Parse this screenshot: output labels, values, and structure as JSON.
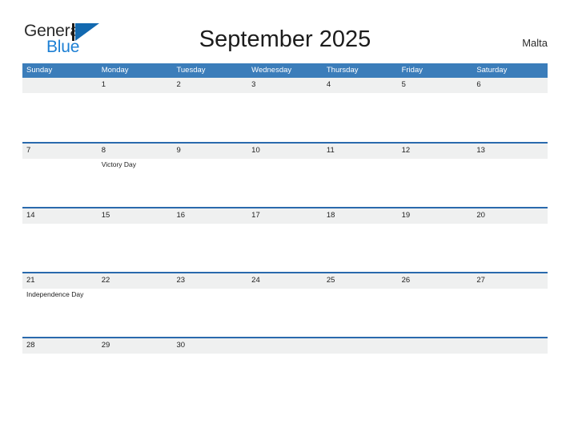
{
  "brand": {
    "name_part1": "General",
    "name_part2": "Blue",
    "color_primary": "#1c7fd4",
    "color_triangle": "#1269b0"
  },
  "header": {
    "title": "September 2025",
    "locale": "Malta"
  },
  "calendar": {
    "header_bg": "#3b7dba",
    "row_divider": "#2a6aad",
    "date_band_bg": "#eff0f0",
    "weekdays": [
      "Sunday",
      "Monday",
      "Tuesday",
      "Wednesday",
      "Thursday",
      "Friday",
      "Saturday"
    ],
    "weeks": [
      [
        {
          "date": ""
        },
        {
          "date": "1"
        },
        {
          "date": "2"
        },
        {
          "date": "3"
        },
        {
          "date": "4"
        },
        {
          "date": "5"
        },
        {
          "date": "6"
        }
      ],
      [
        {
          "date": "7"
        },
        {
          "date": "8",
          "event": "Victory Day"
        },
        {
          "date": "9"
        },
        {
          "date": "10"
        },
        {
          "date": "11"
        },
        {
          "date": "12"
        },
        {
          "date": "13"
        }
      ],
      [
        {
          "date": "14"
        },
        {
          "date": "15"
        },
        {
          "date": "16"
        },
        {
          "date": "17"
        },
        {
          "date": "18"
        },
        {
          "date": "19"
        },
        {
          "date": "20"
        }
      ],
      [
        {
          "date": "21",
          "event": "Independence Day"
        },
        {
          "date": "22"
        },
        {
          "date": "23"
        },
        {
          "date": "24"
        },
        {
          "date": "25"
        },
        {
          "date": "26"
        },
        {
          "date": "27"
        }
      ],
      [
        {
          "date": "28"
        },
        {
          "date": "29"
        },
        {
          "date": "30"
        },
        {
          "date": ""
        },
        {
          "date": ""
        },
        {
          "date": ""
        },
        {
          "date": ""
        }
      ]
    ]
  }
}
